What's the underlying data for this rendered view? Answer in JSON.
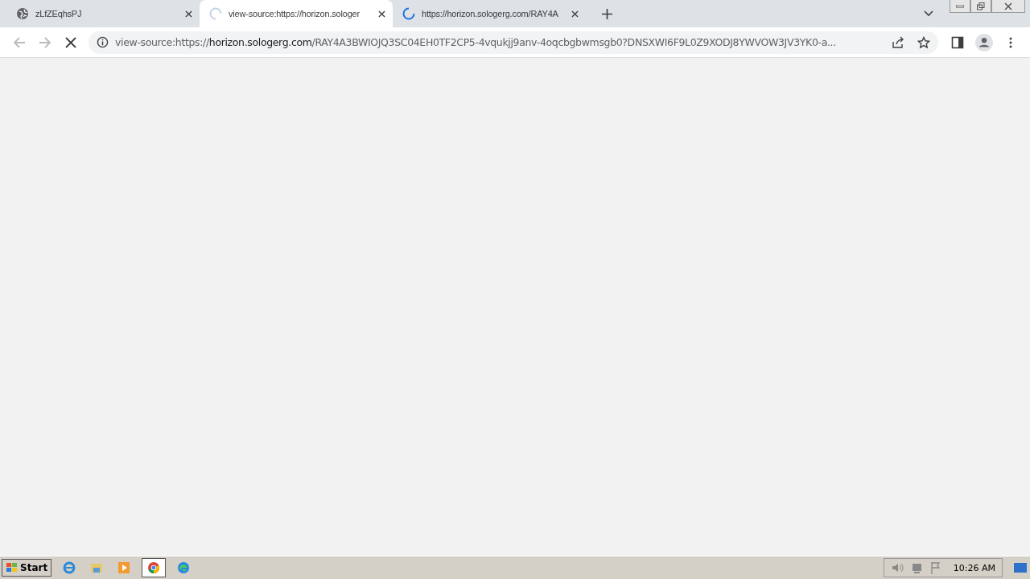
{
  "tabs": [
    {
      "title": "zLfZEqhsPJ",
      "selected": false,
      "kind": "globe"
    },
    {
      "title": "view-source:https://horizon.sologer",
      "selected": true,
      "kind": "loading-faint"
    },
    {
      "title": "https://horizon.sologerg.com/RAY4A",
      "selected": false,
      "kind": "loading"
    }
  ],
  "address": {
    "prefix": "view-source:https://",
    "host": "horizon.sologerg.com",
    "path": "/RAY4A3BWIOJQ3SC04EH0TF2CP5-4vqukjj9anv-4oqcbgbwmsgb0?DNSXWI6F9L0Z9XODJ8YWVOW3JV3YK0-a..."
  },
  "taskbar": {
    "start": "Start",
    "apps": [
      {
        "kind": "ie",
        "active": false
      },
      {
        "kind": "folder",
        "active": false
      },
      {
        "kind": "media",
        "active": false
      },
      {
        "kind": "chrome",
        "active": true
      },
      {
        "kind": "edge",
        "active": false
      }
    ],
    "clock": "10:26 AM"
  }
}
